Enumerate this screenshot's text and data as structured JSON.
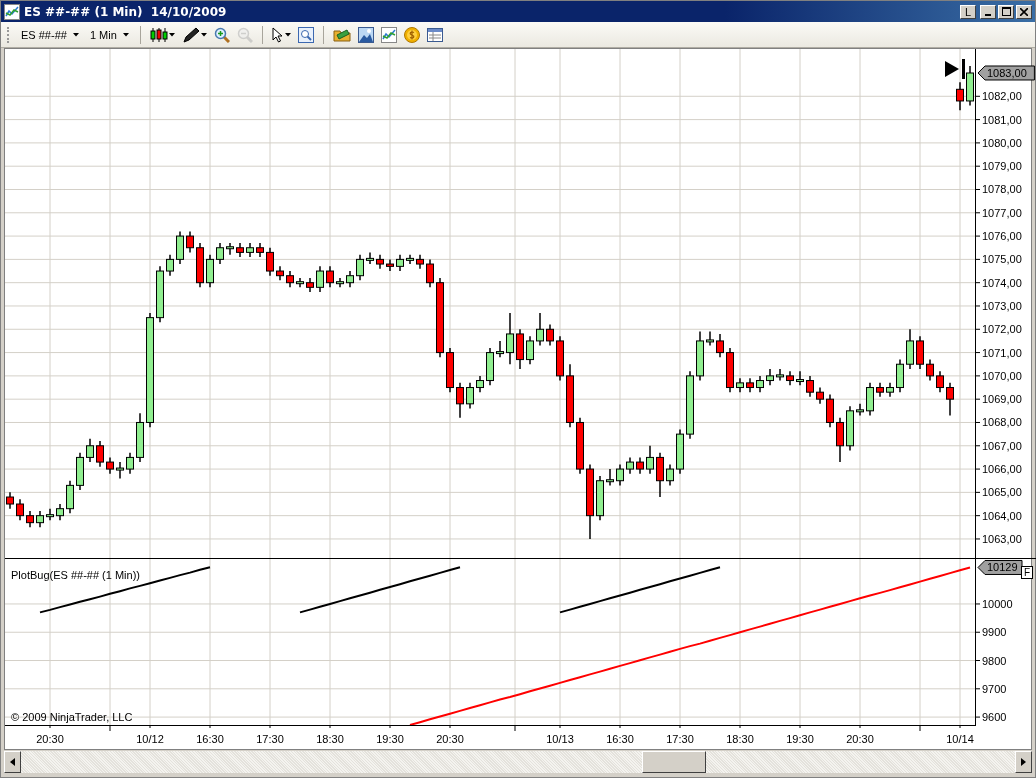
{
  "window": {
    "title": "ES ##-## (1 Min)  14/10/2009",
    "buttons": [
      {
        "kind": "link",
        "label": "L"
      },
      {
        "kind": "minimize"
      },
      {
        "kind": "maximize"
      },
      {
        "kind": "close"
      }
    ]
  },
  "toolbar": [
    {
      "kind": "instrument",
      "label": "ES ##-##"
    },
    {
      "kind": "interval",
      "label": "1 Min"
    },
    {
      "kind": "separator"
    },
    {
      "kind": "candles",
      "dropdown": true,
      "disabled": false
    },
    {
      "kind": "pen",
      "dropdown": true,
      "disabled": false
    },
    {
      "kind": "zoom-in",
      "dropdown": false,
      "disabled": false
    },
    {
      "kind": "zoom-out",
      "dropdown": false,
      "disabled": true
    },
    {
      "kind": "separator"
    },
    {
      "kind": "pointer",
      "dropdown": true,
      "disabled": false
    },
    {
      "kind": "zoom-box",
      "dropdown": false,
      "disabled": false
    },
    {
      "kind": "separator"
    },
    {
      "kind": "folder",
      "dropdown": false,
      "disabled": false
    },
    {
      "kind": "picture",
      "dropdown": false,
      "disabled": false
    },
    {
      "kind": "chart",
      "dropdown": false,
      "disabled": false
    },
    {
      "kind": "coin",
      "dropdown": false,
      "disabled": false
    },
    {
      "kind": "table",
      "dropdown": false,
      "disabled": false
    }
  ],
  "price_panel": {
    "chart_data": {
      "type": "candlestick",
      "grid": true,
      "categories": [
        null,
        null,
        null,
        null,
        null,
        null,
        null,
        null,
        null,
        null,
        null,
        null,
        null,
        null,
        null,
        null,
        null,
        null,
        null,
        null,
        null,
        null,
        null,
        null,
        null,
        null,
        null,
        null,
        null,
        null,
        null,
        null,
        null,
        null,
        null,
        null,
        null,
        null,
        null,
        null,
        null,
        null,
        null,
        null,
        null,
        null,
        null,
        null,
        null,
        null,
        null,
        null,
        null,
        null,
        null,
        null,
        null,
        null,
        null,
        null,
        null,
        null,
        null,
        null,
        null,
        null,
        null,
        null,
        null,
        null,
        null,
        null,
        null,
        null,
        null,
        null,
        null,
        null,
        null,
        null,
        null,
        null,
        null,
        null,
        null,
        null,
        null,
        null,
        null,
        null,
        null,
        null,
        null,
        null,
        null,
        null,
        null
      ],
      "ohlc": [
        [
          1064.8,
          1065,
          1064.3,
          1064.5
        ],
        [
          1064.5,
          1064.7,
          1063.8,
          1064
        ],
        [
          1064,
          1064.2,
          1063.5,
          1063.7
        ],
        [
          1063.7,
          1064.2,
          1063.5,
          1064
        ],
        [
          1064,
          1064.3,
          1063.8,
          1064
        ],
        [
          1064,
          1064.5,
          1063.8,
          1064.3
        ],
        [
          1064.3,
          1065.5,
          1064.1,
          1065.3
        ],
        [
          1065.3,
          1066.7,
          1065.1,
          1066.5
        ],
        [
          1066.5,
          1067.3,
          1066.3,
          1067
        ],
        [
          1067,
          1067.2,
          1066.1,
          1066.3
        ],
        [
          1066.3,
          1066.5,
          1065.8,
          1066
        ],
        [
          1066,
          1066.3,
          1065.6,
          1066
        ],
        [
          1066,
          1066.7,
          1065.8,
          1066.5
        ],
        [
          1066.5,
          1068.4,
          1066.3,
          1068
        ],
        [
          1068,
          1072.7,
          1067.8,
          1072.5
        ],
        [
          1072.5,
          1074.7,
          1072.3,
          1074.5
        ],
        [
          1074.5,
          1075.2,
          1074.3,
          1075
        ],
        [
          1075,
          1076.2,
          1074.8,
          1076
        ],
        [
          1076,
          1076.2,
          1075.3,
          1075.5
        ],
        [
          1075.5,
          1075.7,
          1073.8,
          1074
        ],
        [
          1074,
          1075.2,
          1073.8,
          1075
        ],
        [
          1075,
          1075.7,
          1074.8,
          1075.5
        ],
        [
          1075.5,
          1075.7,
          1075.2,
          1075.5
        ],
        [
          1075.5,
          1075.7,
          1075.1,
          1075.3
        ],
        [
          1075.3,
          1075.7,
          1075.1,
          1075.5
        ],
        [
          1075.5,
          1075.7,
          1075.1,
          1075.3
        ],
        [
          1075.3,
          1075.5,
          1074.3,
          1074.5
        ],
        [
          1074.5,
          1074.7,
          1074.1,
          1074.3
        ],
        [
          1074.3,
          1074.5,
          1073.8,
          1074
        ],
        [
          1074,
          1074.2,
          1073.8,
          1074
        ],
        [
          1074,
          1074.2,
          1073.6,
          1073.8
        ],
        [
          1073.8,
          1074.7,
          1073.6,
          1074.5
        ],
        [
          1074.5,
          1074.7,
          1073.8,
          1074
        ],
        [
          1074,
          1074.2,
          1073.8,
          1074
        ],
        [
          1074,
          1074.5,
          1073.8,
          1074.3
        ],
        [
          1074.3,
          1075.2,
          1074.1,
          1075
        ],
        [
          1075,
          1075.3,
          1074.8,
          1075
        ],
        [
          1075,
          1075.2,
          1074.6,
          1074.8
        ],
        [
          1074.8,
          1075,
          1074.5,
          1074.7
        ],
        [
          1074.7,
          1075.2,
          1074.5,
          1075
        ],
        [
          1075,
          1075.2,
          1074.8,
          1075
        ],
        [
          1075,
          1075.2,
          1074.6,
          1074.8
        ],
        [
          1074.8,
          1075,
          1073.8,
          1074
        ],
        [
          1074,
          1074.2,
          1070.8,
          1071
        ],
        [
          1071,
          1071.2,
          1069.3,
          1069.5
        ],
        [
          1069.5,
          1069.7,
          1068.2,
          1068.8
        ],
        [
          1068.8,
          1069.7,
          1068.6,
          1069.5
        ],
        [
          1069.5,
          1070,
          1069.3,
          1069.8
        ],
        [
          1069.8,
          1071.2,
          1069.6,
          1071
        ],
        [
          1071,
          1071.5,
          1070.8,
          1071
        ],
        [
          1071,
          1072.7,
          1070.5,
          1071.8
        ],
        [
          1071.8,
          1072,
          1070.3,
          1070.7
        ],
        [
          1070.7,
          1071.7,
          1070.5,
          1071.5
        ],
        [
          1071.5,
          1072.7,
          1071.3,
          1072
        ],
        [
          1072,
          1072.2,
          1071.3,
          1071.5
        ],
        [
          1071.5,
          1071.7,
          1069.8,
          1070
        ],
        [
          1070,
          1070.5,
          1067.8,
          1068
        ],
        [
          1068,
          1068.2,
          1065.8,
          1066
        ],
        [
          1066,
          1066.2,
          1063,
          1064
        ],
        [
          1064,
          1065.7,
          1063.8,
          1065.5
        ],
        [
          1065.5,
          1066,
          1065.3,
          1065.5
        ],
        [
          1065.5,
          1066.2,
          1065.3,
          1066
        ],
        [
          1066,
          1066.5,
          1065.8,
          1066.3
        ],
        [
          1066.3,
          1066.5,
          1065.8,
          1066
        ],
        [
          1066,
          1067,
          1065.8,
          1066.5
        ],
        [
          1066.5,
          1066.7,
          1064.8,
          1065.5
        ],
        [
          1065.5,
          1066.2,
          1065.3,
          1066
        ],
        [
          1066,
          1067.7,
          1065.8,
          1067.5
        ],
        [
          1067.5,
          1070.2,
          1067.3,
          1070
        ],
        [
          1070,
          1071.9,
          1069.8,
          1071.5
        ],
        [
          1071.5,
          1071.9,
          1071.3,
          1071.5
        ],
        [
          1071.5,
          1071.8,
          1070.8,
          1071
        ],
        [
          1071,
          1071.2,
          1069.3,
          1069.5
        ],
        [
          1069.5,
          1069.9,
          1069.3,
          1069.7
        ],
        [
          1069.7,
          1069.9,
          1069.3,
          1069.5
        ],
        [
          1069.5,
          1070,
          1069.3,
          1069.8
        ],
        [
          1069.8,
          1070.3,
          1069.6,
          1070
        ],
        [
          1070,
          1070.3,
          1069.8,
          1070
        ],
        [
          1070,
          1070.2,
          1069.6,
          1069.8
        ],
        [
          1069.8,
          1070.2,
          1069.6,
          1069.8
        ],
        [
          1069.8,
          1070,
          1069.1,
          1069.3
        ],
        [
          1069.3,
          1069.5,
          1068.8,
          1069
        ],
        [
          1069,
          1069.2,
          1067.8,
          1068
        ],
        [
          1068,
          1068.2,
          1066.3,
          1067
        ],
        [
          1067,
          1068.7,
          1066.8,
          1068.5
        ],
        [
          1068.5,
          1068.8,
          1068.3,
          1068.5
        ],
        [
          1068.5,
          1069.7,
          1068.3,
          1069.5
        ],
        [
          1069.5,
          1069.7,
          1069.1,
          1069.3
        ],
        [
          1069.3,
          1069.7,
          1069.1,
          1069.5
        ],
        [
          1069.5,
          1070.7,
          1069.3,
          1070.5
        ],
        [
          1070.5,
          1072,
          1070.3,
          1071.5
        ],
        [
          1071.5,
          1071.7,
          1070.3,
          1070.5
        ],
        [
          1070.5,
          1070.7,
          1069.8,
          1070
        ],
        [
          1070,
          1070.2,
          1069.3,
          1069.5
        ],
        [
          1069.5,
          1069.7,
          1068.3,
          1069
        ],
        [
          1082.3,
          1082.6,
          1081.4,
          1081.8
        ],
        [
          1081.8,
          1083.3,
          1081.6,
          1083
        ]
      ],
      "ylim": [
        1062.14,
        1084.03
      ],
      "yticks": [
        {
          "value": 1063,
          "label": "1063,00"
        },
        {
          "value": 1064,
          "label": "1064,00"
        },
        {
          "value": 1065,
          "label": "1065,00"
        },
        {
          "value": 1066,
          "label": "1066,00"
        },
        {
          "value": 1067,
          "label": "1067,00"
        },
        {
          "value": 1068,
          "label": "1068,00"
        },
        {
          "value": 1069,
          "label": "1069,00"
        },
        {
          "value": 1070,
          "label": "1070,00"
        },
        {
          "value": 1071,
          "label": "1071,00"
        },
        {
          "value": 1072,
          "label": "1072,00"
        },
        {
          "value": 1073,
          "label": "1073,00"
        },
        {
          "value": 1074,
          "label": "1074,00"
        },
        {
          "value": 1075,
          "label": "1075,00"
        },
        {
          "value": 1076,
          "label": "1076,00"
        },
        {
          "value": 1077,
          "label": "1077,00"
        },
        {
          "value": 1078,
          "label": "1078,00"
        },
        {
          "value": 1079,
          "label": "1079,00"
        },
        {
          "value": 1080,
          "label": "1080,00"
        },
        {
          "value": 1081,
          "label": "1081,00"
        },
        {
          "value": 1082,
          "label": "1082,00"
        }
      ],
      "annotations": [
        "1083,00"
      ]
    }
  },
  "indicator_panel": {
    "button": "F",
    "copyright": "© 2009 NinjaTrader, LLC",
    "chart_data": {
      "type": "line",
      "grid": true,
      "title": "PlotBug(ES ##-## (1 Min))",
      "categories": [
        null,
        null,
        null,
        null,
        "20:30",
        null,
        null,
        null,
        null,
        null,
        null,
        null,
        null,
        null,
        "10/12",
        null,
        null,
        null,
        null,
        null,
        "16:30",
        null,
        null,
        null,
        null,
        null,
        "17:30",
        null,
        null,
        null,
        null,
        null,
        "18:30",
        null,
        null,
        null,
        null,
        null,
        "19:30",
        null,
        null,
        null,
        null,
        null,
        "20:30",
        null,
        null,
        null,
        null,
        null,
        null,
        null,
        null,
        null,
        null,
        "10/13",
        null,
        null,
        null,
        null,
        null,
        "16:30",
        null,
        null,
        null,
        null,
        null,
        "17:30",
        null,
        null,
        null,
        null,
        null,
        "18:30",
        null,
        null,
        null,
        null,
        null,
        "19:30",
        null,
        null,
        null,
        null,
        null,
        "20:30",
        null,
        null,
        null,
        null,
        null,
        null,
        null,
        null,
        null,
        "10/14",
        null
      ],
      "series": [
        {
          "color": "#000000",
          "values": [
            null,
            null,
            null,
            9970,
            9979,
            9989,
            9998,
            10008,
            10017,
            10026,
            10036,
            10045,
            10055,
            10064,
            10073,
            10083,
            10092,
            10102,
            10111,
            10121,
            10130,
            null,
            null,
            null,
            null,
            null,
            null,
            null,
            null,
            9970,
            9980,
            9990,
            10000,
            10010,
            10020,
            10030,
            10040,
            10050,
            10060,
            10070,
            10080,
            10090,
            10100,
            10110,
            10120,
            10130,
            null,
            null,
            null,
            null,
            null,
            null,
            null,
            null,
            null,
            9970,
            9980,
            9990,
            10000,
            10010,
            10020,
            10030,
            10040,
            10050,
            10060,
            10070,
            10080,
            10090,
            10100,
            10110,
            10120,
            10130,
            null,
            null,
            null,
            null,
            null,
            null,
            null,
            null,
            null,
            null,
            null,
            null,
            null,
            null,
            null,
            null,
            null,
            null,
            null,
            null,
            null,
            null,
            null,
            null,
            null
          ]
        },
        {
          "color": "#ff0000",
          "values": [
            null,
            null,
            null,
            null,
            null,
            null,
            null,
            null,
            null,
            null,
            null,
            null,
            null,
            null,
            null,
            null,
            null,
            null,
            null,
            null,
            null,
            null,
            null,
            null,
            null,
            null,
            null,
            null,
            null,
            null,
            null,
            null,
            null,
            null,
            null,
            null,
            null,
            null,
            null,
            null,
            9572,
            9582,
            9592,
            9602,
            9612,
            9622,
            9632,
            9642,
            9652,
            9662,
            9671,
            9681,
            9691,
            9701,
            9711,
            9721,
            9731,
            9741,
            9751,
            9761,
            9771,
            9781,
            9791,
            9801,
            9811,
            9821,
            9831,
            9841,
            9851,
            9860,
            9870,
            9880,
            9890,
            9900,
            9910,
            9920,
            9930,
            9940,
            9950,
            9960,
            9970,
            9980,
            9990,
            10000,
            10010,
            10020,
            10030,
            10039,
            10049,
            10059,
            10069,
            10079,
            10089,
            10099,
            10109,
            10119,
            10129
          ]
        }
      ],
      "ylim": [
        9572,
        10159
      ],
      "yticks": [
        {
          "value": 9600,
          "label": "9600"
        },
        {
          "value": 9700,
          "label": "9700"
        },
        {
          "value": 9800,
          "label": "9800"
        },
        {
          "value": 9900,
          "label": "9900"
        },
        {
          "value": 10000,
          "label": "10000"
        }
      ],
      "annotations": [
        "10129"
      ]
    }
  }
}
